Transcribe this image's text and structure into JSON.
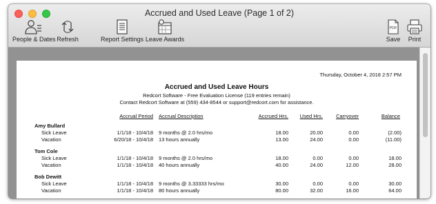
{
  "window": {
    "title": "Accrued and Used Leave  (Page 1 of 2)"
  },
  "toolbar": {
    "people_dates": "People & Dates",
    "refresh": "Refresh",
    "report_settings": "Report Settings",
    "leave_awards": "Leave Awards",
    "save": "Save",
    "print": "Print",
    "pdf_badge": "PDF"
  },
  "report": {
    "datetime": "Thursday, October 4, 2018  2:57 PM",
    "title": "Accrued and Used Leave Hours",
    "subtitle1": "Redcort Software - Free Evaluation License (119 entries remain)",
    "subtitle2": "Contact Redcort Software at (559) 434-8544 or support@redcort.com for assistance.",
    "columns": {
      "period": "Accrual Period",
      "description": "Accrual Description",
      "accrued": "Accrued Hrs.",
      "used": "Used Hrs.",
      "carryover": "Carryover",
      "balance": "Balance"
    },
    "employees": [
      {
        "name": "Amy Bullard",
        "rows": [
          {
            "type": "Sick Leave",
            "period": "1/1/18 - 10/4/18",
            "description": "9 months @ 2.0 hrs/mo",
            "accrued": "18.00",
            "used": "20.00",
            "carryover": "0.00",
            "balance": "(2.00)"
          },
          {
            "type": "Vacation",
            "period": "6/20/18 - 10/4/18",
            "description": "13 hours annually",
            "accrued": "13.00",
            "used": "24.00",
            "carryover": "0.00",
            "balance": "(11.00)"
          }
        ]
      },
      {
        "name": "Tom Cole",
        "rows": [
          {
            "type": "Sick Leave",
            "period": "1/1/18 - 10/4/18",
            "description": "9 months @ 2.0 hrs/mo",
            "accrued": "18.00",
            "used": "0.00",
            "carryover": "0.00",
            "balance": "18.00"
          },
          {
            "type": "Vacation",
            "period": "1/1/18 - 10/4/18",
            "description": "40 hours annually",
            "accrued": "40.00",
            "used": "24.00",
            "carryover": "12.00",
            "balance": "28.00"
          }
        ]
      },
      {
        "name": "Bob Dewitt",
        "rows": [
          {
            "type": "Sick Leave",
            "period": "1/1/18 - 10/4/18",
            "description": "9 months @ 3.33333 hrs/mo",
            "accrued": "30.00",
            "used": "0.00",
            "carryover": "0.00",
            "balance": "30.00"
          },
          {
            "type": "Vacation",
            "period": "1/1/18 - 10/4/18",
            "description": "80 hours annually",
            "accrued": "80.00",
            "used": "32.00",
            "carryover": "16.00",
            "balance": "64.00"
          }
        ]
      }
    ]
  }
}
